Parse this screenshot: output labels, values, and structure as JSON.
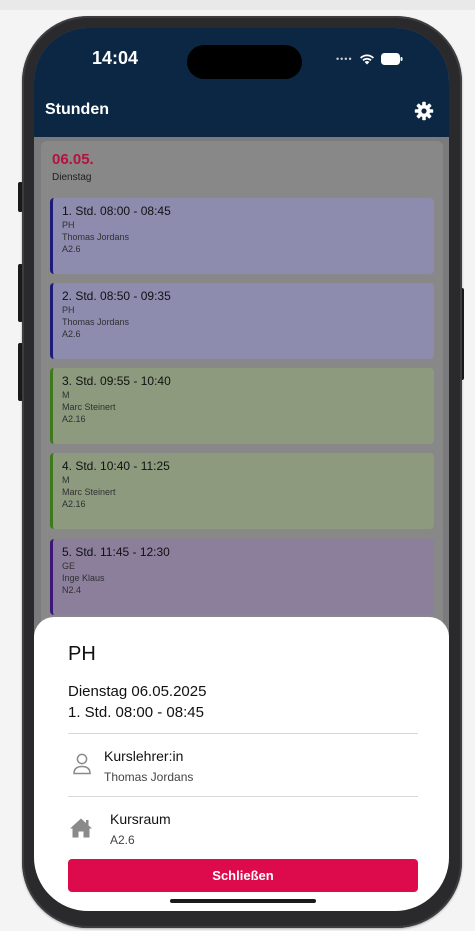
{
  "status_bar": {
    "time": "14:04"
  },
  "app": {
    "title": "Stunden",
    "settings_icon": "gear-icon"
  },
  "day": {
    "date": "06.05.",
    "weekday": "Dienstag",
    "date_color": "#b3123d"
  },
  "lessons": [
    {
      "title": "1. Std. 08:00 - 08:45",
      "subject": "PH",
      "teacher": "Thomas Jordans",
      "room": "A2.6",
      "bg": "#8d8bae",
      "accent": "#1d1a7a"
    },
    {
      "title": "2. Std. 08:50 - 09:35",
      "subject": "PH",
      "teacher": "Thomas Jordans",
      "room": "A2.6",
      "bg": "#8d8bae",
      "accent": "#1d1a7a"
    },
    {
      "title": "3. Std. 09:55 - 10:40",
      "subject": "M",
      "teacher": "Marc Steinert",
      "room": "A2.16",
      "bg": "#8d9a7d",
      "accent": "#3e7a1c"
    },
    {
      "title": "4. Std. 10:40 - 11:25",
      "subject": "M",
      "teacher": "Marc Steinert",
      "room": "A2.16",
      "bg": "#8d9a7d",
      "accent": "#3e7a1c"
    },
    {
      "title": "5. Std. 11:45 - 12:30",
      "subject": "GE",
      "teacher": "Inge Klaus",
      "room": "N2.4",
      "bg": "#8b7f9c",
      "accent": "#3e1678"
    }
  ],
  "sheet": {
    "subject": "PH",
    "date": "Dienstag 06.05.2025",
    "period": "1. Std. 08:00 - 08:45",
    "teacher_label": "Kurslehrer:in",
    "teacher_value": "Thomas Jordans",
    "teacher_icon": "person-icon",
    "room_label": "Kursraum",
    "room_value": "A2.6",
    "room_icon": "house-icon",
    "close_label": "Schließen",
    "close_color": "#dd0a4c"
  }
}
